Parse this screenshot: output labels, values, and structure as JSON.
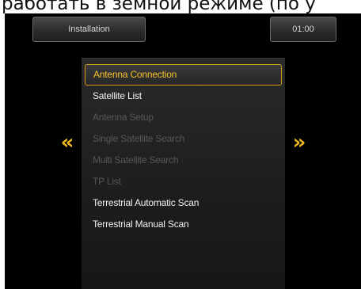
{
  "caption": "работать в земной режиме (по у",
  "header": {
    "title": "Installation",
    "time": "01:00"
  },
  "navigation": {
    "prev_arrow": "«",
    "next_arrow": "»"
  },
  "menu": {
    "items": [
      {
        "label": "Antenna Connection",
        "state": "selected"
      },
      {
        "label": "Satellite List",
        "state": "enabled"
      },
      {
        "label": "Antenna Setup",
        "state": "disabled"
      },
      {
        "label": "Single Satellite Search",
        "state": "disabled"
      },
      {
        "label": "Multi Satellite Search",
        "state": "disabled"
      },
      {
        "label": "TP List",
        "state": "disabled"
      },
      {
        "label": "Terrestrial Automatic Scan",
        "state": "enabled"
      },
      {
        "label": "Terrestrial Manual Scan",
        "state": "enabled"
      }
    ]
  },
  "colors": {
    "highlight_text": "#f6c12a",
    "highlight_border": "#d39a12",
    "arrow": "#f0b81e",
    "disabled_text": "#575757"
  }
}
